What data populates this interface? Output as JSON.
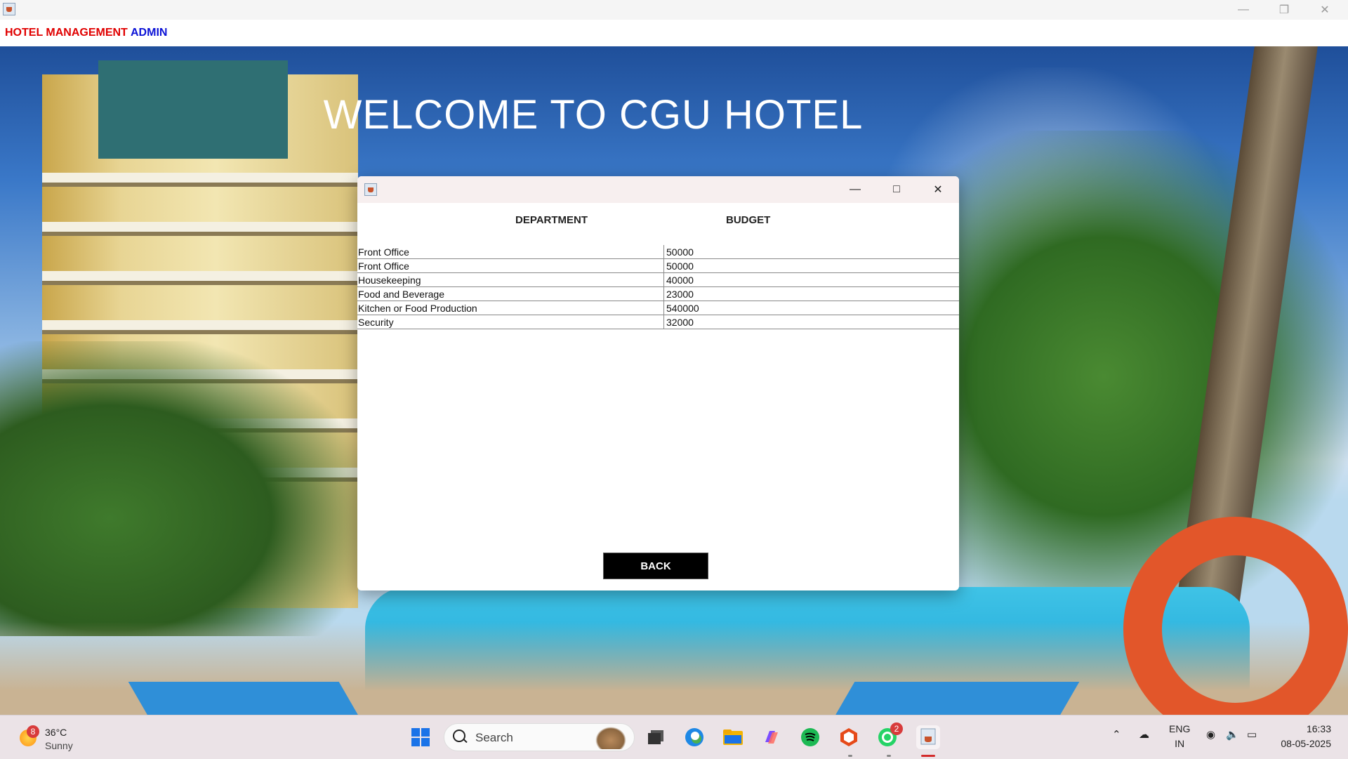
{
  "window": {
    "controls": {
      "minimize": "—",
      "maximize": "❐",
      "close": "✕"
    }
  },
  "menu": {
    "items": [
      {
        "label": "HOTEL MANAGEMENT",
        "color": "#e00000"
      },
      {
        "label": "ADMIN",
        "color": "#0b12d6"
      }
    ]
  },
  "background": {
    "heading": "WELCOME TO CGU HOTEL"
  },
  "dialog": {
    "controls": {
      "minimize": "—",
      "maximize": "□",
      "close": "✕"
    },
    "columns": [
      "DEPARTMENT",
      "BUDGET"
    ],
    "rows": [
      {
        "department": "Front Office",
        "budget": "50000"
      },
      {
        "department": "Front Office",
        "budget": "50000"
      },
      {
        "department": "Housekeeping",
        "budget": "40000"
      },
      {
        "department": "Food and Beverage",
        "budget": "23000"
      },
      {
        "department": "Kitchen or Food Production",
        "budget": "540000"
      },
      {
        "department": "Security",
        "budget": "32000"
      }
    ],
    "back_button": "BACK"
  },
  "taskbar": {
    "weather": {
      "temp": "36°C",
      "condition": "Sunny",
      "badge": "8"
    },
    "search": {
      "label": "Search"
    },
    "apps": [
      {
        "name": "start-icon"
      },
      {
        "name": "task-view-icon"
      },
      {
        "name": "edge-icon"
      },
      {
        "name": "file-explorer-icon"
      },
      {
        "name": "copilot-icon"
      },
      {
        "name": "spotify-icon"
      },
      {
        "name": "office-icon"
      },
      {
        "name": "whatsapp-icon",
        "badge": "2"
      },
      {
        "name": "java-app-icon"
      }
    ],
    "tray": {
      "language_line1": "ENG",
      "language_line2": "IN"
    },
    "clock": {
      "time": "16:33",
      "date": "08-05-2025"
    }
  }
}
